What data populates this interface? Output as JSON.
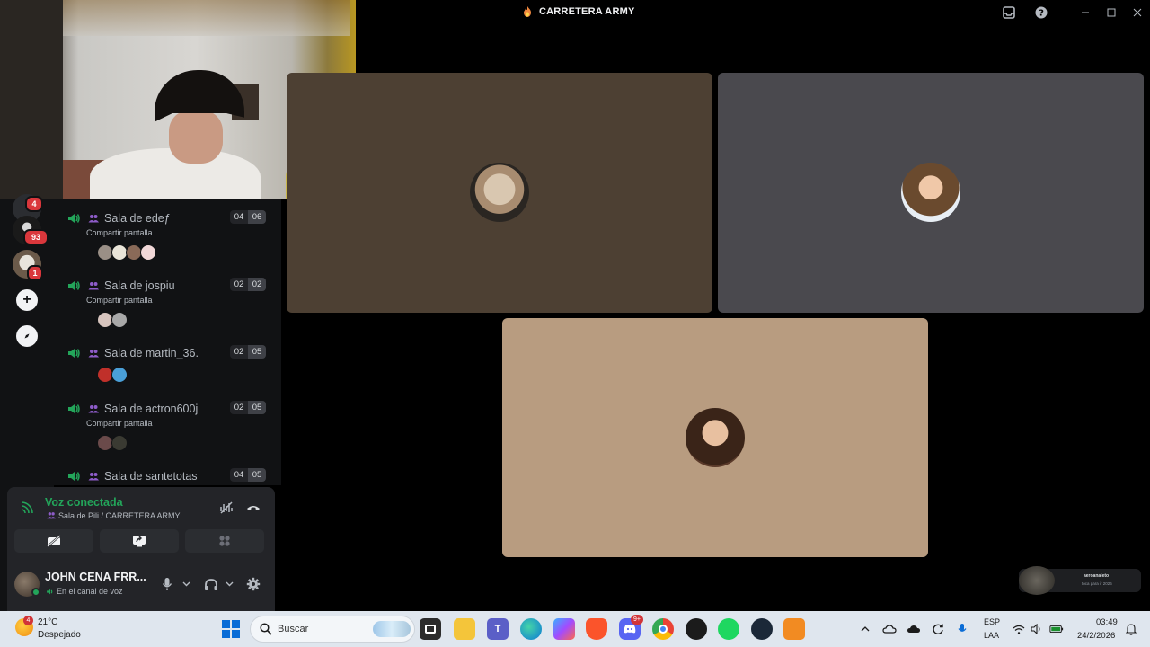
{
  "window": {
    "title": "CARRETERA ARMY",
    "title_icon": "flame-icon",
    "buttons": [
      "inbox-icon",
      "help-icon",
      "minimize-icon",
      "maximize-icon",
      "close-icon"
    ]
  },
  "server_rail": {
    "items": [
      {
        "icon": "server-avatar-top",
        "badge": "4"
      },
      {
        "icon": "server-avatar-pirate",
        "badge": "93"
      },
      {
        "icon": "server-avatar-dog",
        "badge": "1"
      },
      {
        "icon": "add-server-icon",
        "badge": ""
      },
      {
        "icon": "explore-icon",
        "badge": ""
      }
    ]
  },
  "voice_rooms": [
    {
      "name": "Sala de edeƒ",
      "sub": "Compartir pantalla",
      "count_a": "04",
      "count_b": "06",
      "avatars": [
        "#9a8f86",
        "#e9e4d8",
        "#8a6a58",
        "#f1d8d8"
      ]
    },
    {
      "name": "Sala de jospiu",
      "sub": "Compartir pantalla",
      "count_a": "02",
      "count_b": "02",
      "avatars": [
        "#d7c4be",
        "#a8a8a8"
      ]
    },
    {
      "name": "Sala de martin_36.",
      "sub": "",
      "count_a": "02",
      "count_b": "05",
      "avatars": [
        "#c0302a",
        "#4a9fd8"
      ]
    },
    {
      "name": "Sala de actron600j",
      "sub": "Compartir pantalla",
      "count_a": "02",
      "count_b": "05",
      "avatars": [
        "#6a4a4a",
        "#3a3a32"
      ]
    },
    {
      "name": "Sala de santetotas",
      "sub": "",
      "count_a": "04",
      "count_b": "05",
      "avatars": []
    }
  ],
  "voice_panel": {
    "status": "Voz conectada",
    "room": "Sala de Pili / CARRETERA ARMY",
    "colors": {
      "connected": "#23a55a"
    }
  },
  "user_panel": {
    "name": "JOHN CENA FRR...",
    "status": "En el canal de voz"
  },
  "video_tiles": [
    {
      "participant": "participant-1",
      "bg": "#4d4033"
    },
    {
      "participant": "participant-2",
      "bg": "#4a494e"
    },
    {
      "participant": "participant-3",
      "bg": "#b89c80"
    }
  ],
  "mini_tile": {
    "line1": "aeroanaleto",
    "line2": "toca para ir 2026"
  },
  "taskbar": {
    "weather_badge": "4",
    "temperature": "21°C",
    "weather": "Despejado",
    "search_placeholder": "Buscar",
    "lang_line1": "ESP",
    "lang_line2": "LAA",
    "time": "03:49",
    "date": "24/2/2026",
    "apps": [
      "task-view-icon",
      "file-explorer-icon",
      "teams-icon",
      "edge-icon",
      "copilot-icon",
      "brave-icon",
      "discord-icon",
      "chrome-icon",
      "obs-icon",
      "spotify-icon",
      "steam-icon",
      "fl-studio-icon"
    ],
    "discord_badge": "9+"
  }
}
